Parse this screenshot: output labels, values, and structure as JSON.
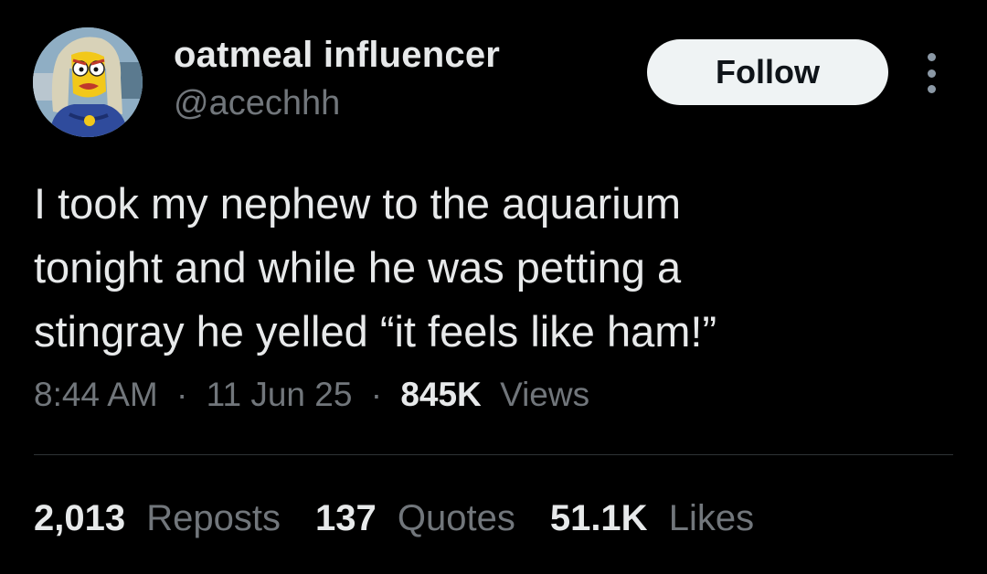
{
  "user": {
    "display_name": "oatmeal influencer",
    "handle": "@acechhh",
    "avatar_icon": "cartoon-character-avatar"
  },
  "actions": {
    "follow_label": "Follow",
    "more_icon": "more-options-icon"
  },
  "tweet": {
    "lines": [
      "I took my nephew to the aquarium",
      "tonight and while he was petting a",
      "stingray he yelled “it feels like ham!”"
    ]
  },
  "meta": {
    "time": "8:44 AM",
    "separator": "·",
    "date": "11 Jun 25",
    "views_count": "845K",
    "views_label": "Views"
  },
  "stats": {
    "reposts_count": "2,013",
    "reposts_label": "Reposts",
    "quotes_count": "137",
    "quotes_label": "Quotes",
    "likes_count": "51.1K",
    "likes_label": "Likes"
  },
  "colors": {
    "background": "#000000",
    "primary_text": "#e7e9ea",
    "secondary_text": "#71767b",
    "follow_bg": "#eff3f4",
    "divider": "#2f3336"
  }
}
